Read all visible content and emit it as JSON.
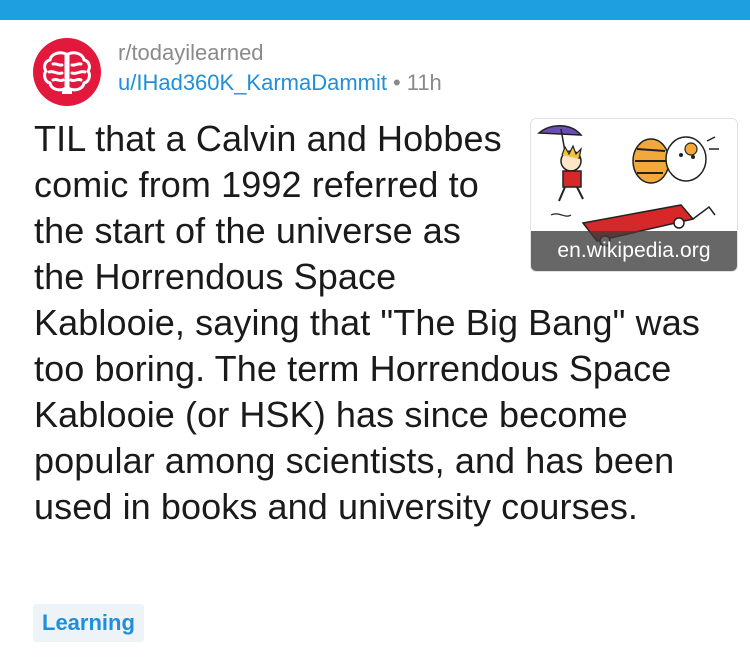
{
  "header": {
    "subreddit": "r/todayilearned",
    "username": "u/IHad360K_KarmaDammit",
    "separator": "•",
    "age": "11h"
  },
  "post": {
    "title": "TIL that a Calvin and Hobbes comic from 1992 referred to the start of the universe as the Horrendous Space Kablooie, saying that \"The Big Bang\" was too boring. The term Horrendous Space Kablooie (or HSK) has since become popular among scientists, and has been used in books and university courses.",
    "thumbnail_domain": "en.wikipedia.org",
    "flair": "Learning"
  },
  "colors": {
    "top_bar": "#1e9fe0",
    "avatar_bg": "#e3183d",
    "link_blue": "#1e8fd8",
    "meta_gray": "#8a8a8a",
    "flair_bg": "#eef3f8"
  },
  "icons": {
    "avatar": "brain-icon"
  }
}
